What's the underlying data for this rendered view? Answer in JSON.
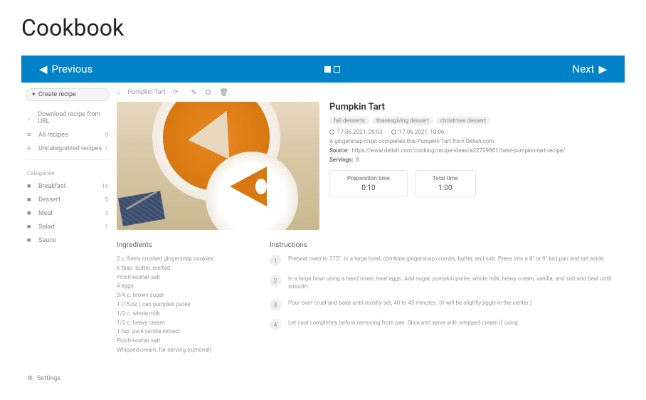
{
  "page": {
    "title": "Cookbook"
  },
  "slider": {
    "prev": "Previous",
    "next": "Next"
  },
  "sidebar": {
    "create": "Create recipe",
    "items": [
      {
        "icon": "↓",
        "label": "Download recipe from URL",
        "count": ""
      },
      {
        "icon": "≡",
        "label": "All recipes",
        "count": "9"
      },
      {
        "icon": "≡",
        "label": "Uncategorized recipes",
        "count": "1"
      }
    ],
    "categories_title": "Categories",
    "categories": [
      {
        "label": "Breakfast",
        "count": "14"
      },
      {
        "label": "Dessert",
        "count": "5"
      },
      {
        "label": "Meal",
        "count": "3"
      },
      {
        "label": "Salad",
        "count": "1"
      },
      {
        "label": "Sauce",
        "count": ""
      }
    ],
    "settings": "Settings"
  },
  "breadcrumb": {
    "section": "",
    "title": "Pumpkin Tart"
  },
  "recipe": {
    "title": "Pumpkin Tart",
    "tags": [
      "fall desserts",
      "thanksgiving dessert",
      "christmas dessert"
    ],
    "created": "17.06.2021, 09:03",
    "modified": "17.06.2021, 10:06",
    "description": "A gingersnap crust completes this Pumpkin Tart from Delish.com.",
    "source_label": "Source:",
    "source": "https://www.delish.com/cooking/recipe-ideas/a22729881/best-pumpkin-tart-recipe/",
    "servings_label": "Servings:",
    "servings": "8",
    "prep_label": "Preparation time",
    "prep_value": "0:10",
    "total_label": "Total time",
    "total_value": "1:00",
    "ingredients_title": "Ingredients",
    "ingredients": [
      "2 c. finely crushed gingersnap cookies",
      "6 tbsp. butter, melted",
      "Pinch kosher salt",
      "4 eggs",
      "3/4 c. brown sugar",
      "1 (15-oz.) can pumpkin purée",
      "1/2 c. whole milk",
      "1/2 c. heavy cream",
      "1 tsp. pure vanilla extract",
      "Pinch kosher salt",
      "Whipped cream, for serving (optional)"
    ],
    "instructions_title": "Instructions",
    "steps": [
      "Preheat oven to 375°. In a large bowl, combine gingersnap crumbs, butter, and salt. Press into a 8\" or 9\" tart pan and set aside.",
      "In a large bowl using a hand mixer, beat eggs. Add sugar, pumpkin purée, whole milk, heavy cream, vanilla, and salt and beat until smooth.",
      "Pour over crust and bake until mostly set, 40 to 45 minutes. (It will be slightly jiggly in the center.)",
      "Let cool completely before removing from pan. Slice and serve with whipped cream if using."
    ]
  }
}
